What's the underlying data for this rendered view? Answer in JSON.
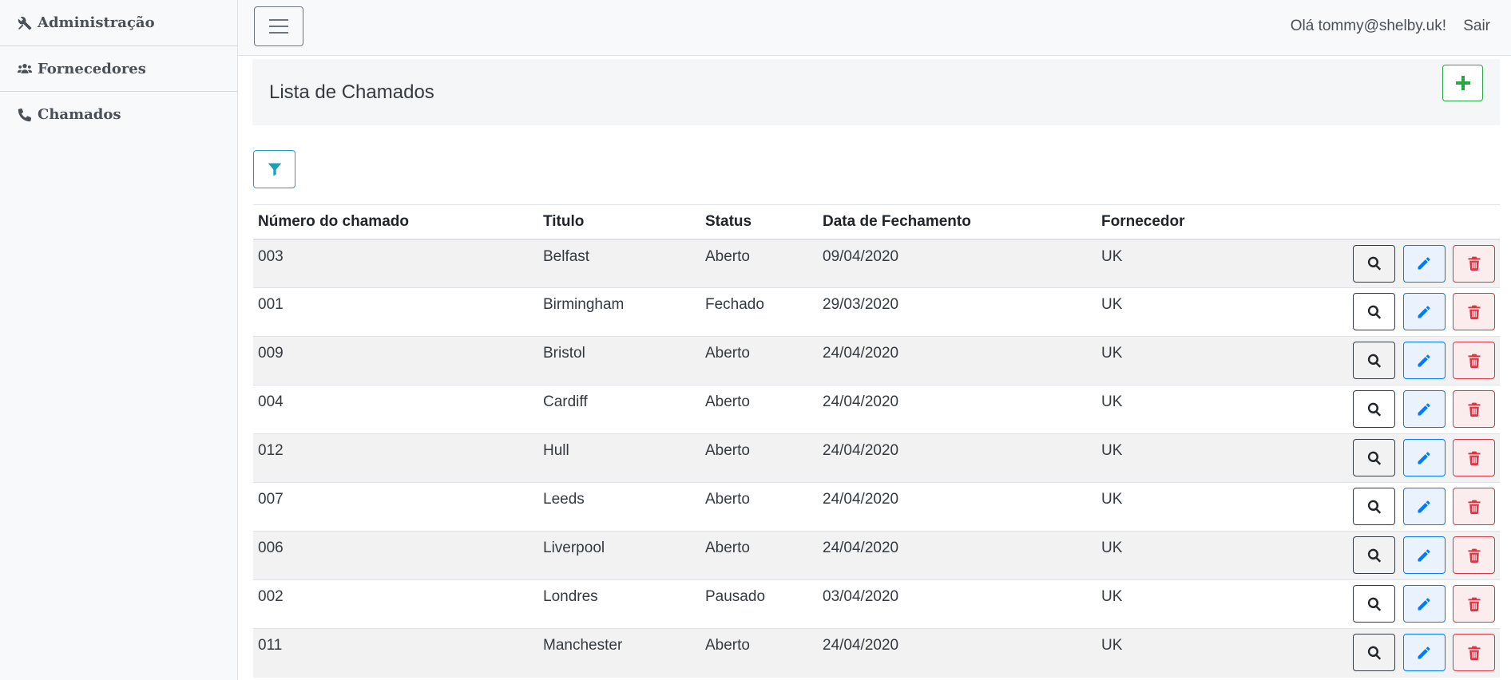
{
  "sidebar": {
    "items": [
      {
        "label": "Administração",
        "icon": "tools-icon"
      },
      {
        "label": "Fornecedores",
        "icon": "users-icon"
      },
      {
        "label": "Chamados",
        "icon": "phone-icon"
      }
    ]
  },
  "topbar": {
    "greeting": "Olá tommy@shelby.uk!",
    "logout_label": "Sair"
  },
  "page": {
    "title": "Lista de Chamados"
  },
  "table": {
    "headers": [
      "Número do chamado",
      "Titulo",
      "Status",
      "Data de Fechamento",
      "Fornecedor"
    ],
    "rows": [
      {
        "numero": "003",
        "titulo": "Belfast",
        "status": "Aberto",
        "data": "09/04/2020",
        "fornecedor": "UK"
      },
      {
        "numero": "001",
        "titulo": "Birmingham",
        "status": "Fechado",
        "data": "29/03/2020",
        "fornecedor": "UK"
      },
      {
        "numero": "009",
        "titulo": "Bristol",
        "status": "Aberto",
        "data": "24/04/2020",
        "fornecedor": "UK"
      },
      {
        "numero": "004",
        "titulo": "Cardiff",
        "status": "Aberto",
        "data": "24/04/2020",
        "fornecedor": "UK"
      },
      {
        "numero": "012",
        "titulo": "Hull",
        "status": "Aberto",
        "data": "24/04/2020",
        "fornecedor": "UK"
      },
      {
        "numero": "007",
        "titulo": "Leeds",
        "status": "Aberto",
        "data": "24/04/2020",
        "fornecedor": "UK"
      },
      {
        "numero": "006",
        "titulo": "Liverpool",
        "status": "Aberto",
        "data": "24/04/2020",
        "fornecedor": "UK"
      },
      {
        "numero": "002",
        "titulo": "Londres",
        "status": "Pausado",
        "data": "03/04/2020",
        "fornecedor": "UK"
      },
      {
        "numero": "011",
        "titulo": "Manchester",
        "status": "Aberto",
        "data": "24/04/2020",
        "fornecedor": "UK"
      }
    ]
  },
  "colors": {
    "accent_add": "#28a745",
    "accent_filter": "#17a2b8",
    "accent_edit": "#007bff",
    "accent_delete": "#dc3545",
    "stripe": "#f2f2f2"
  }
}
